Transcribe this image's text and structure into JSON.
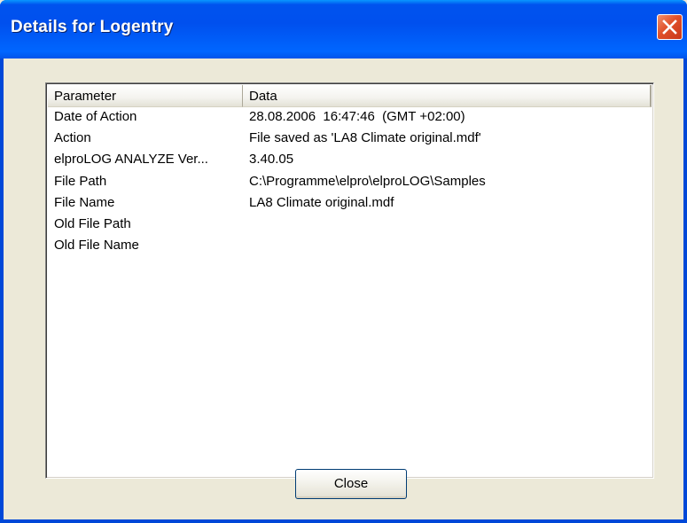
{
  "window": {
    "title": "Details for Logentry",
    "close_glyph": "close-icon"
  },
  "listview": {
    "columns": [
      "Parameter",
      "Data"
    ],
    "rows": [
      {
        "parameter": "Date of Action",
        "data": "28.08.2006  16:47:46  (GMT +02:00)"
      },
      {
        "parameter": "Action",
        "data": "File saved as 'LA8 Climate original.mdf'"
      },
      {
        "parameter": "elproLOG ANALYZE Ver...",
        "data": "3.40.05"
      },
      {
        "parameter": "File Path",
        "data": "C:\\Programme\\elpro\\elproLOG\\Samples"
      },
      {
        "parameter": "File Name",
        "data": "LA8 Climate original.mdf"
      },
      {
        "parameter": "Old File Path",
        "data": ""
      },
      {
        "parameter": "Old File Name",
        "data": ""
      }
    ]
  },
  "buttons": {
    "close_label": "Close"
  },
  "colors": {
    "titlebar": "#0054e3",
    "close_button": "#e0502a",
    "dialog_background": "#ece9d8"
  }
}
